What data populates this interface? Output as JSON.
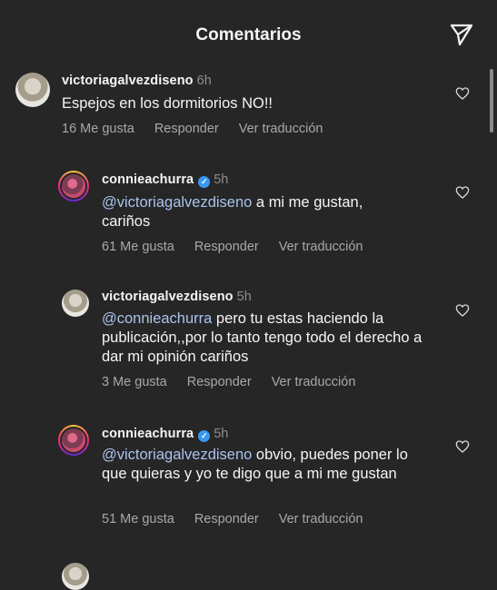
{
  "header": {
    "title": "Comentarios"
  },
  "comments": [
    {
      "username": "victoriagalvezdiseno",
      "time": "6h",
      "verified": false,
      "mention": "",
      "text": "Espejos  en los dormitorios  NO!!",
      "likes": "16 Me gusta",
      "reply": "Responder",
      "translate": "Ver traducción"
    },
    {
      "username": "connieachurra",
      "time": "5h",
      "verified": true,
      "mention": "@victoriagalvezdiseno",
      "text": " a mi me gustan, cariños",
      "likes": "61 Me gusta",
      "reply": "Responder",
      "translate": "Ver traducción"
    },
    {
      "username": "victoriagalvezdiseno",
      "time": "5h",
      "verified": false,
      "mention": "@connieachurra",
      "text": " pero tu estas  haciendo  la publicación,,por lo tanto tengo todo el derecho  a dar mi opinión  cariños",
      "likes": "3 Me gusta",
      "reply": "Responder",
      "translate": "Ver traducción"
    },
    {
      "username": "connieachurra",
      "time": "5h",
      "verified": true,
      "mention": "@victoriagalvezdiseno",
      "text": " obvio, puedes poner lo que quieras y yo te digo que a mi me gustan",
      "likes": "51 Me gusta",
      "reply": "Responder",
      "translate": "Ver traducción"
    }
  ],
  "icons": {
    "send": "send-icon",
    "like": "heart-icon",
    "verified": "verified-badge-icon"
  },
  "colors": {
    "background": "#262626",
    "mention": "#a9c3ee",
    "verified": "#3897f0",
    "secondary_text": "#a8a8a8"
  }
}
